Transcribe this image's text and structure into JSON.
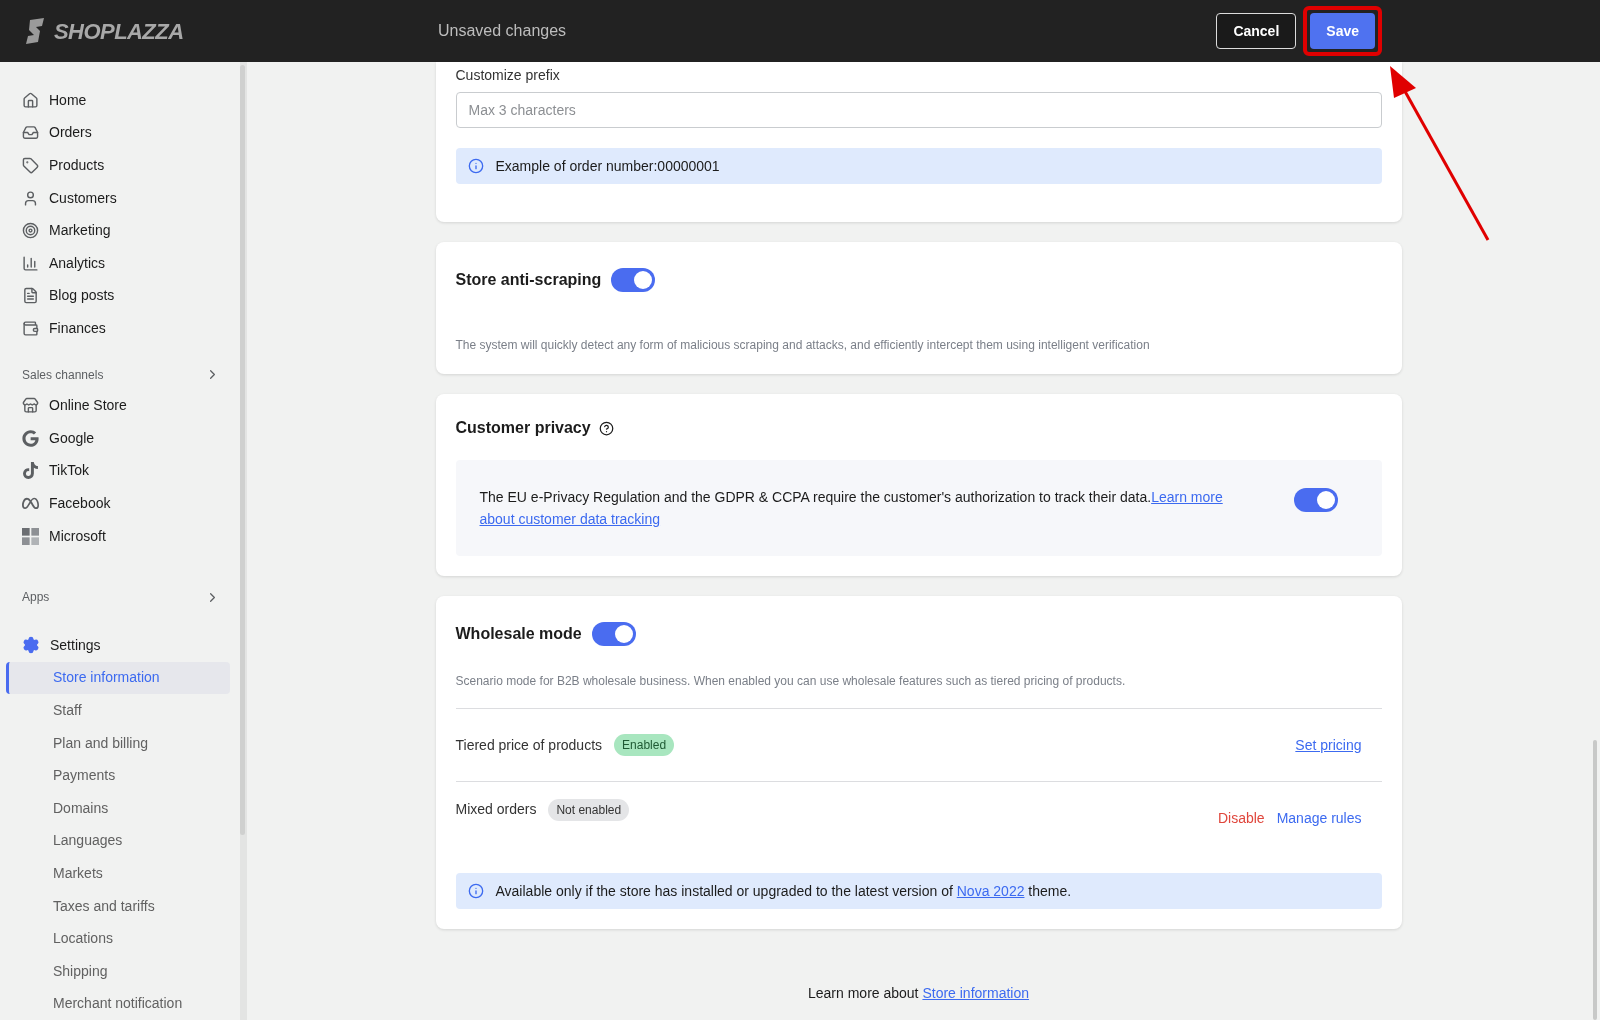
{
  "header": {
    "logo": "SHOPLAZZA",
    "title": "Unsaved changes",
    "buttons": [
      {
        "label": "Cancel",
        "kind": "secondary",
        "highlighted": false
      },
      {
        "label": "Save",
        "kind": "primary",
        "highlighted": true
      }
    ]
  },
  "sidebar": {
    "main": [
      "Home",
      "Orders",
      "Products",
      "Customers",
      "Marketing",
      "Analytics",
      "Blog posts",
      "Finances"
    ],
    "sales_channels": {
      "title": "Sales channels",
      "items": [
        "Online Store",
        "Google",
        "TikTok",
        "Facebook",
        "Microsoft"
      ]
    },
    "apps": {
      "title": "Apps"
    },
    "settings": {
      "label": "Settings",
      "children": [
        {
          "label": "Store information",
          "selected": true
        },
        {
          "label": "Staff",
          "selected": false
        },
        {
          "label": "Plan and billing",
          "selected": false
        },
        {
          "label": "Payments",
          "selected": false
        },
        {
          "label": "Domains",
          "selected": false
        },
        {
          "label": "Languages",
          "selected": false
        },
        {
          "label": "Markets",
          "selected": false
        },
        {
          "label": "Taxes and tariffs",
          "selected": false
        },
        {
          "label": "Locations",
          "selected": false
        },
        {
          "label": "Shipping",
          "selected": false
        },
        {
          "label": "Merchant notification",
          "selected": false
        }
      ]
    }
  },
  "prefix_card": {
    "label": "Customize prefix",
    "placeholder": "Max 3 characters",
    "info": "Example of order number:00000001"
  },
  "anti_scraping": {
    "title": "Store anti-scraping",
    "on": true,
    "description": "The system will quickly detect any form of malicious scraping and attacks, and efficiently intercept them using intelligent verification"
  },
  "customer_privacy": {
    "title": "Customer privacy",
    "text": "The EU e-Privacy Regulation and the GDPR & CCPA require the customer's authorization to track their data.",
    "link_lines": [
      "Learn more",
      "about customer data tracking"
    ],
    "on": true
  },
  "wholesale": {
    "title": "Wholesale mode",
    "on": true,
    "description": "Scenario mode for B2B wholesale business. When enabled you can use wholesale features such as tiered pricing of products.",
    "rows": [
      {
        "label": "Tiered price of products",
        "badge": {
          "text": "Enabled",
          "kind": "success"
        },
        "actions": [
          {
            "label": "Set pricing",
            "kind": "link"
          }
        ]
      },
      {
        "label": "Mixed orders",
        "badge": {
          "text": "Not enabled",
          "kind": "neutral"
        },
        "actions": [
          {
            "label": "Disable",
            "kind": "danger"
          },
          {
            "label": "Manage rules",
            "kind": "plain"
          }
        ]
      }
    ],
    "note": {
      "before": "Available only if the store has installed or upgraded to the latest version of",
      "link": "Nova 2022",
      "after": "theme."
    }
  },
  "footer": {
    "text": "Learn more about",
    "link": "Store information"
  }
}
